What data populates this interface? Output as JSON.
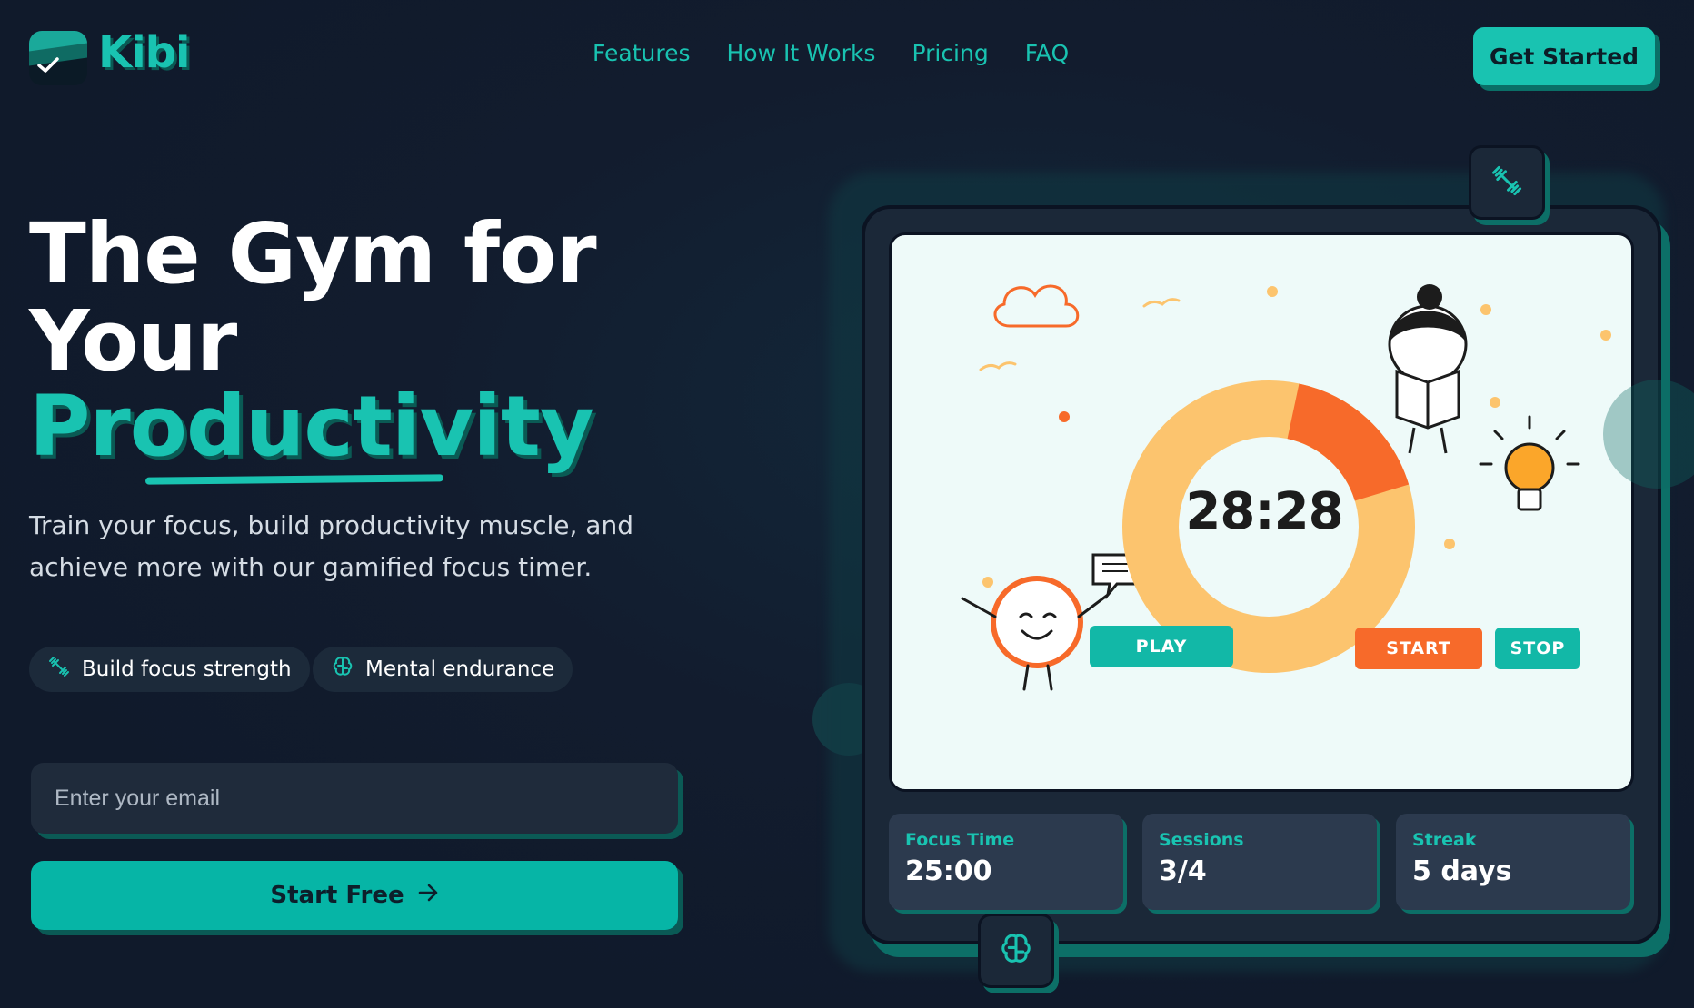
{
  "nav": {
    "brand": "Kibi",
    "links": [
      "Features",
      "How It Works",
      "Pricing",
      "FAQ"
    ],
    "cta": "Get Started"
  },
  "hero": {
    "title_line1": "The Gym for",
    "title_line2": "Your",
    "title_highlight": "Productivity",
    "subtitle": "Train your focus, build productivity muscle, and achieve more with our gamified focus timer.",
    "pills": [
      {
        "icon": "dumbbell-icon",
        "label": "Build focus strength"
      },
      {
        "icon": "brain-icon",
        "label": "Mental endurance"
      }
    ],
    "email_placeholder": "Enter your email",
    "start_button": "Start Free"
  },
  "preview": {
    "timer": "28:28",
    "play": "PLAY",
    "start": "START",
    "stop": "STOP",
    "progress_fraction": 0.17,
    "stats": [
      {
        "label": "Focus Time",
        "value": "25:00"
      },
      {
        "label": "Sessions",
        "value": "3/4"
      },
      {
        "label": "Streak",
        "value": "5 days"
      }
    ]
  },
  "colors": {
    "accent": "#19c3b1",
    "background": "#121c2e",
    "orange": "#f76a2a",
    "donut_light": "#fcc46e"
  }
}
